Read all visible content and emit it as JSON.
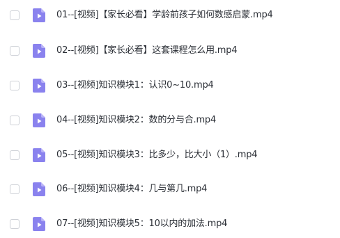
{
  "file_list": {
    "items": [
      {
        "name": "01--[视频]【家长必看】学龄前孩子如何数感启蒙.mp4",
        "icon": "video-file-icon",
        "checked": false
      },
      {
        "name": "02--[视频]【家长必看】这套课程怎么用.mp4",
        "icon": "video-file-icon",
        "checked": false
      },
      {
        "name": "03--[视频]知识模块1：认识0~10.mp4",
        "icon": "video-file-icon",
        "checked": false
      },
      {
        "name": "04--[视频]知识模块2：数的分与合.mp4",
        "icon": "video-file-icon",
        "checked": false
      },
      {
        "name": "05--[视频]知识模块3：比多少，比大小（1）.mp4",
        "icon": "video-file-icon",
        "checked": false
      },
      {
        "name": "06--[视频]知识模块4：几与第几.mp4",
        "icon": "video-file-icon",
        "checked": false
      },
      {
        "name": "07--[视频]知识模块5：10以内的加法.mp4",
        "icon": "video-file-icon",
        "checked": false
      }
    ]
  },
  "colors": {
    "icon_body": "#8a82ee",
    "icon_fold": "#b9b3f7",
    "icon_play": "#ffffff",
    "text": "#2b2f36",
    "checkbox_border": "#cdd0d6"
  }
}
